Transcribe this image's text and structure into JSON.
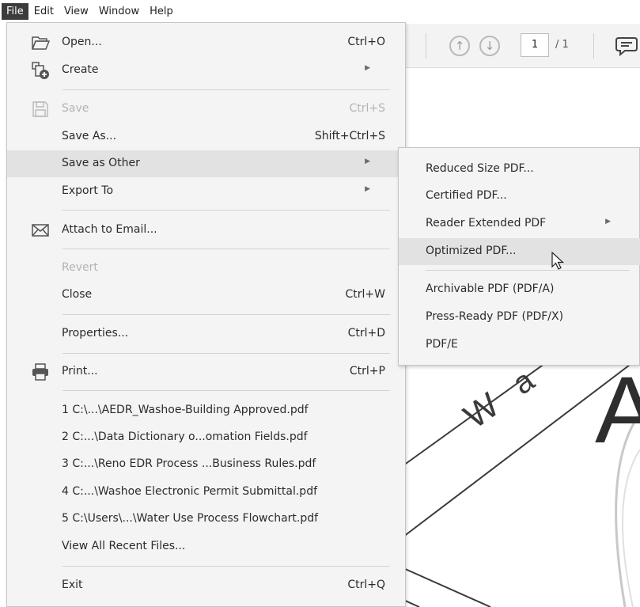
{
  "menubar": {
    "items": [
      "File",
      "Edit",
      "View",
      "Window",
      "Help"
    ]
  },
  "toolbar": {
    "page_number": "1",
    "page_total": "/ 1"
  },
  "document": {
    "big_letter": "A"
  },
  "file_menu": {
    "open": {
      "label": "Open...",
      "shortcut": "Ctrl+O",
      "icon": "folder-open-icon"
    },
    "create": {
      "label": "Create",
      "icon": "create-document-icon"
    },
    "save": {
      "label": "Save",
      "shortcut": "Ctrl+S",
      "icon": "floppy-disk-icon"
    },
    "save_as": {
      "label": "Save As...",
      "shortcut": "Shift+Ctrl+S"
    },
    "save_as_other": {
      "label": "Save as Other"
    },
    "export_to": {
      "label": "Export To"
    },
    "attach_to_email": {
      "label": "Attach to Email...",
      "icon": "envelope-icon"
    },
    "revert": {
      "label": "Revert"
    },
    "close": {
      "label": "Close",
      "shortcut": "Ctrl+W"
    },
    "properties": {
      "label": "Properties...",
      "shortcut": "Ctrl+D"
    },
    "print": {
      "label": "Print...",
      "shortcut": "Ctrl+P",
      "icon": "printer-icon"
    },
    "recent_files": [
      "1 C:\\...\\AEDR_Washoe-Building Approved.pdf",
      "2 C:...\\Data Dictionary o...omation Fields.pdf",
      "3 C:...\\Reno EDR Process ...Business Rules.pdf",
      "4 C:...\\Washoe Electronic Permit Submittal.pdf",
      "5 C:\\Users\\...\\Water Use Process Flowchart.pdf"
    ],
    "view_all_recent": {
      "label": "View All Recent Files..."
    },
    "exit": {
      "label": "Exit",
      "shortcut": "Ctrl+Q"
    }
  },
  "save_as_other_submenu": {
    "items": [
      "Reduced Size PDF...",
      "Certified PDF...",
      "Reader Extended PDF",
      "Optimized PDF...",
      "Archivable PDF (PDF/A)",
      "Press-Ready PDF (PDF/X)",
      "PDF/E"
    ]
  },
  "colors": {
    "menu_bg": "#f4f4f4",
    "hover_bg": "#e2e2e2",
    "active_menubar_bg": "#3c3c3c",
    "disabled_text": "#b3b3b3"
  }
}
